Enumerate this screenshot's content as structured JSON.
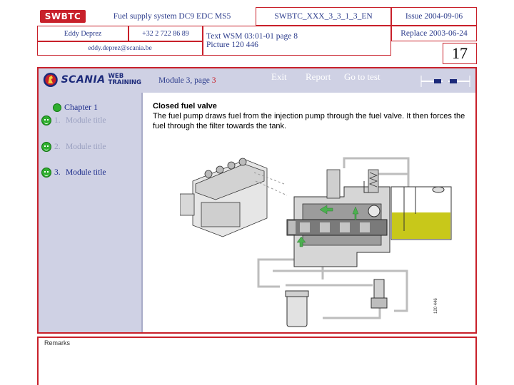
{
  "header": {
    "logo": "SWBTC",
    "title": "Fuel supply system DC9 EDC MS5",
    "doc_code": "SWBTC_XXX_3_3_1_3_EN",
    "issue": "Issue 2004-09-06",
    "author": "Eddy Deprez",
    "phone": "+32 2 722 86 89",
    "email": "eddy.deprez@scania.be",
    "text_ref": "Text WSM 03:01-01 page 8",
    "picture_ref": "Picture 120 446",
    "replace": "Replace 2003-06-24",
    "page_number": "17"
  },
  "topbar": {
    "logo_word": "SCANIA",
    "web_training": "WEB TRAINING",
    "module_prefix": "Module 3, page ",
    "module_page": "3",
    "nav": {
      "exit": "Exit",
      "report": "Report",
      "go_to_test": "Go to test"
    }
  },
  "sidebar": {
    "chapter": "Chapter 1",
    "modules": [
      {
        "num": "1.",
        "title": "Module title",
        "active": false
      },
      {
        "num": "2.",
        "title": "Module title",
        "active": false
      },
      {
        "num": "3.",
        "title": "Module title",
        "active": true
      }
    ]
  },
  "content": {
    "heading": "Closed fuel valve",
    "body": "The fuel pump draws fuel from the injection pump through the fuel valve. It then forces the fuel through the filter towards the tank.",
    "diagram_code": "120 446"
  },
  "remarks": {
    "label": "Remarks"
  },
  "colors": {
    "frame_red": "#c8202a",
    "panel_lavender": "#cfd1e4",
    "status_green": "#2fae2f",
    "fuel_yellow": "#c8c81a"
  }
}
